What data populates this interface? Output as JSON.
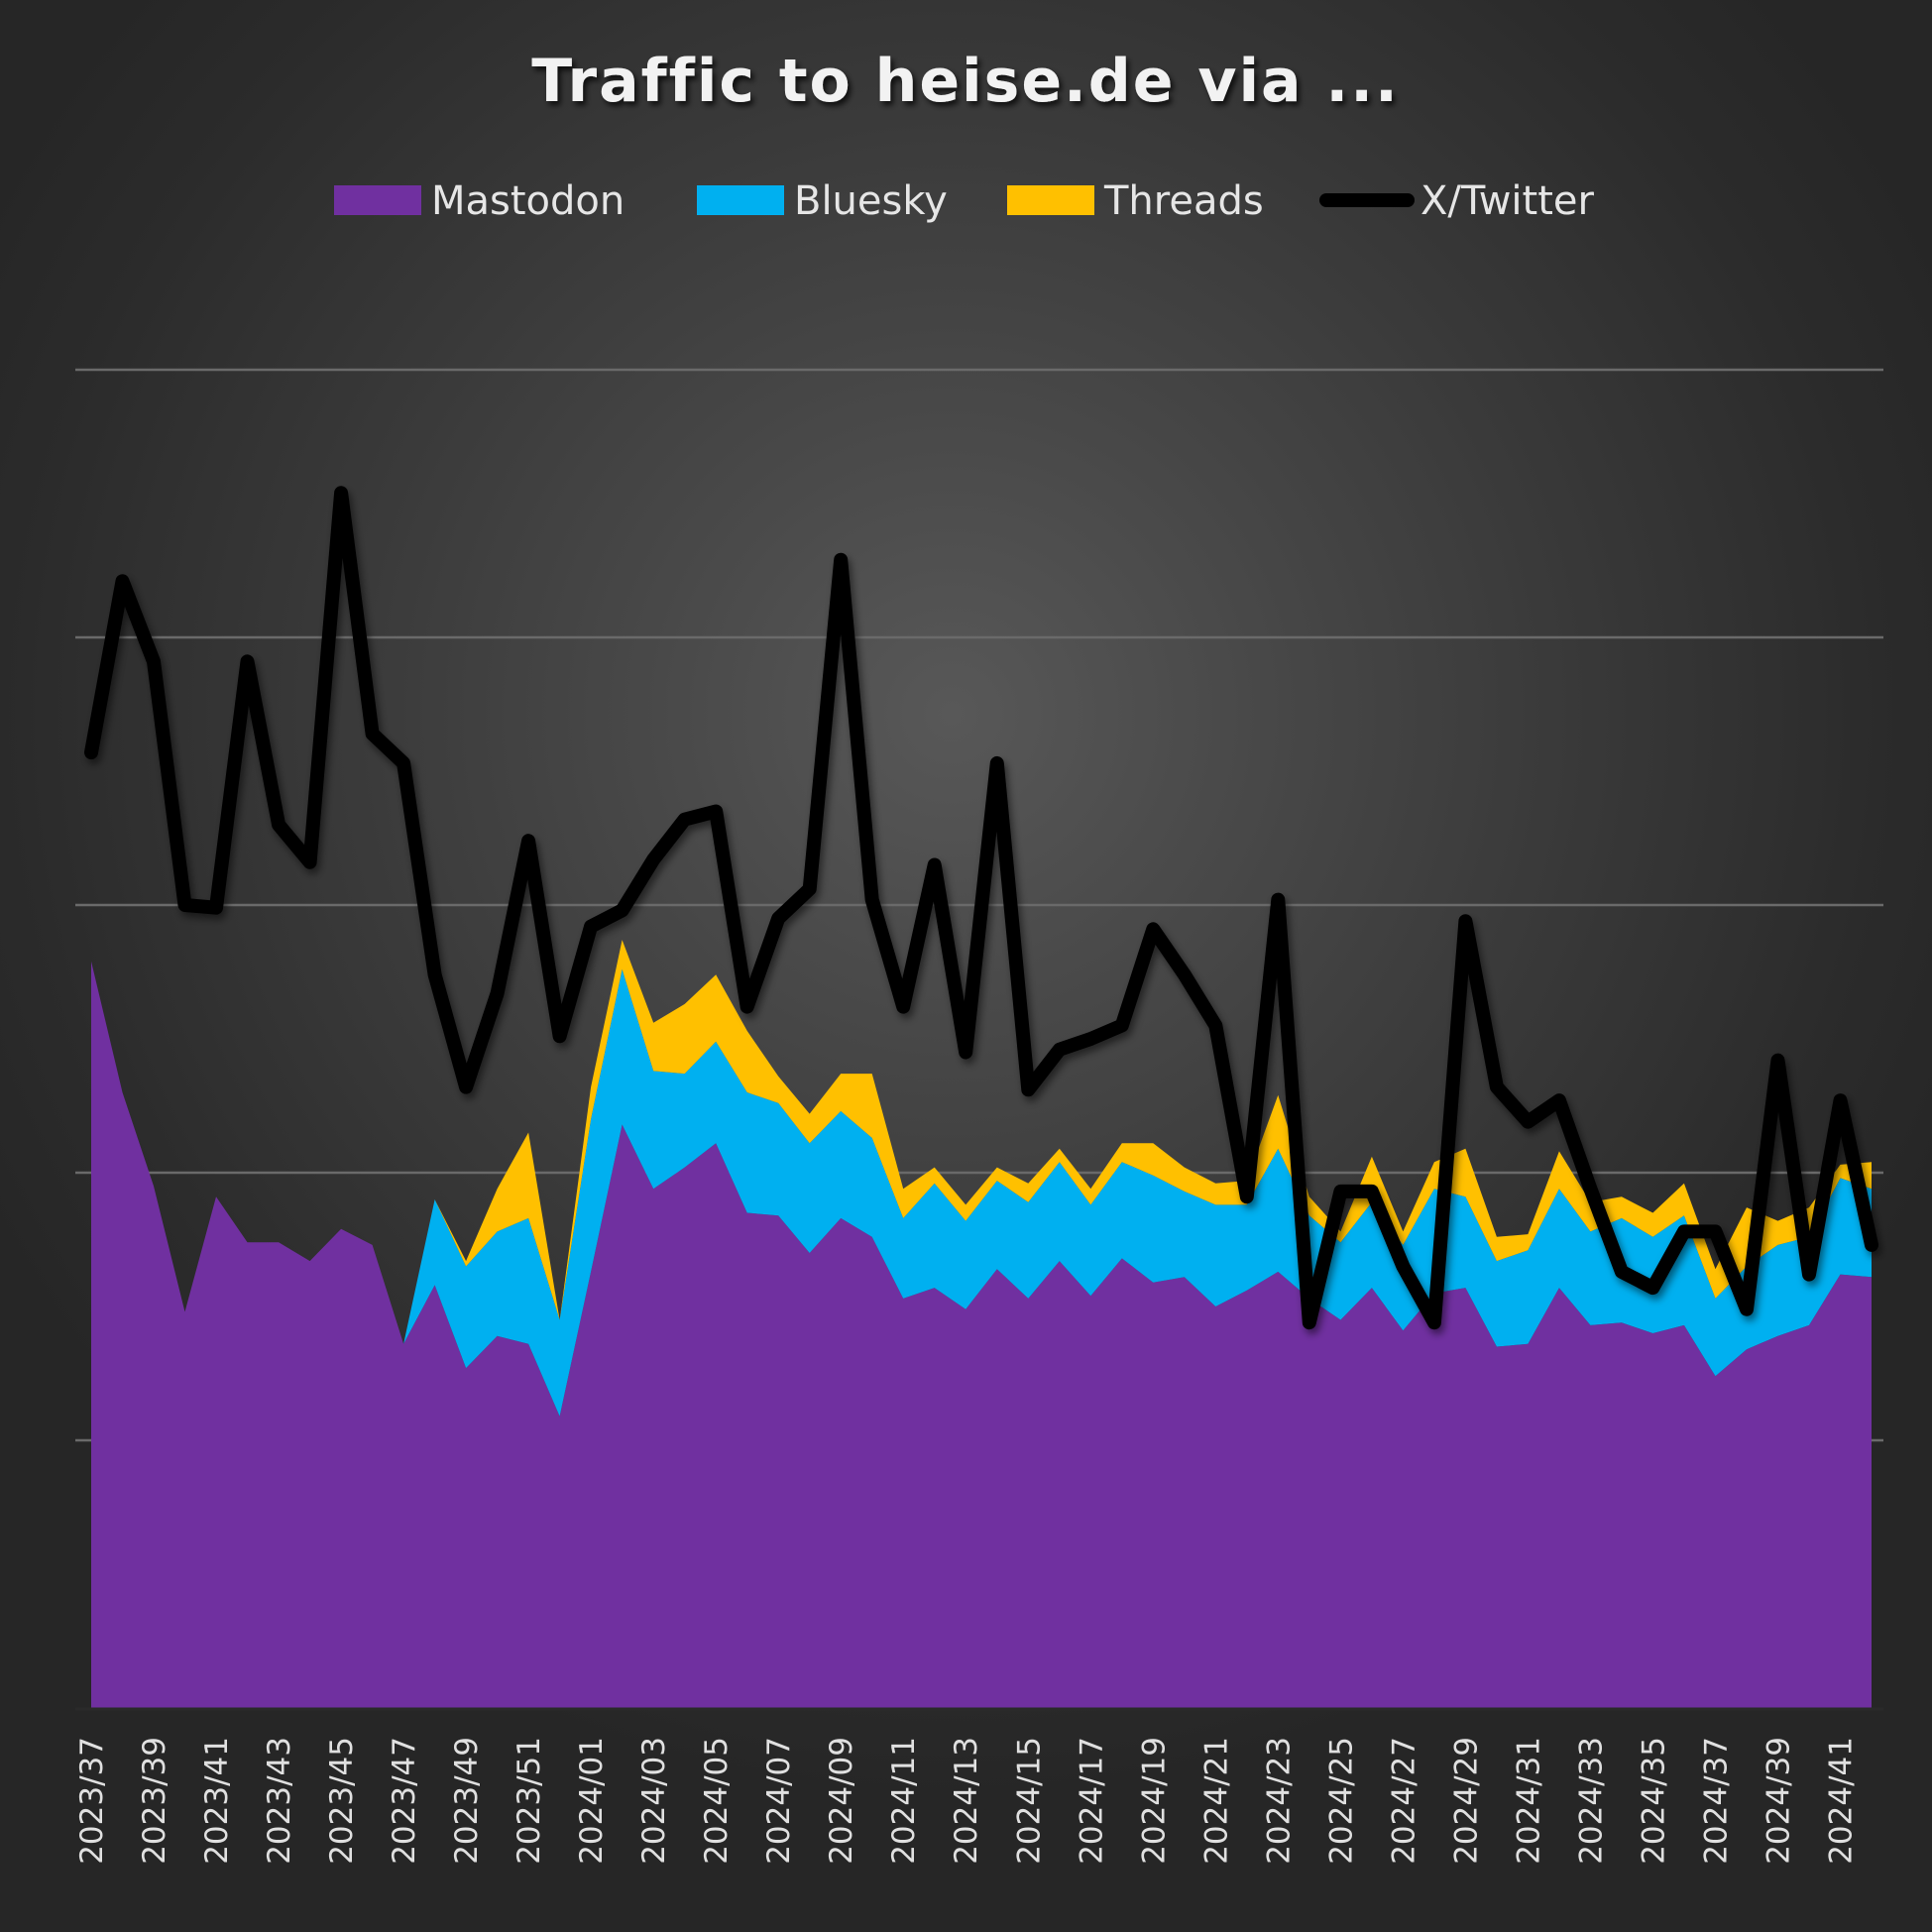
{
  "chart_data": {
    "type": "area",
    "subtype": "stacked area with line overlay",
    "title": "Traffic to heise.de via ...",
    "xlabel": "",
    "ylabel": "",
    "y_units": "relative (unlabeled axis; 1 unit = 1 gridline interval)",
    "ylim": [
      0,
      5
    ],
    "grid": true,
    "legend_position": "top-center",
    "legend": [
      {
        "name": "Mastodon",
        "kind": "area",
        "color": "#7030A0"
      },
      {
        "name": "Bluesky",
        "kind": "area",
        "color": "#00B0F0"
      },
      {
        "name": "Threads",
        "kind": "area",
        "color": "#FFC000"
      },
      {
        "name": "X/Twitter",
        "kind": "line",
        "color": "#000000"
      }
    ],
    "x": [
      "2023/37",
      "2023/38",
      "2023/39",
      "2023/40",
      "2023/41",
      "2023/42",
      "2023/43",
      "2023/44",
      "2023/45",
      "2023/46",
      "2023/47",
      "2023/48",
      "2023/49",
      "2023/50",
      "2023/51",
      "2023/52",
      "2024/01",
      "2024/02",
      "2024/03",
      "2024/04",
      "2024/05",
      "2024/06",
      "2024/07",
      "2024/08",
      "2024/09",
      "2024/10",
      "2024/11",
      "2024/12",
      "2024/13",
      "2024/14",
      "2024/15",
      "2024/16",
      "2024/17",
      "2024/18",
      "2024/19",
      "2024/20",
      "2024/21",
      "2024/22",
      "2024/23",
      "2024/24",
      "2024/25",
      "2024/26",
      "2024/27",
      "2024/28",
      "2024/29",
      "2024/30",
      "2024/31",
      "2024/32",
      "2024/33",
      "2024/34",
      "2024/35",
      "2024/36",
      "2024/37",
      "2024/38",
      "2024/39",
      "2024/40",
      "2024/41",
      "2024/42"
    ],
    "tick_labels": [
      "2023/37",
      "2023/39",
      "2023/41",
      "2023/43",
      "2023/45",
      "2023/47",
      "2023/49",
      "2023/51",
      "2024/01",
      "2024/03",
      "2024/05",
      "2024/07",
      "2024/09",
      "2024/11",
      "2024/13",
      "2024/15",
      "2024/17",
      "2024/19",
      "2024/21",
      "2024/23",
      "2024/25",
      "2024/27",
      "2024/29",
      "2024/31",
      "2024/33",
      "2024/35",
      "2024/37",
      "2024/39",
      "2024/41"
    ],
    "tick_every": 2,
    "series": [
      {
        "name": "Mastodon",
        "stacked": true,
        "values": [
          2.79,
          2.3,
          1.95,
          1.48,
          1.91,
          1.74,
          1.74,
          1.67,
          1.79,
          1.73,
          1.36,
          1.58,
          1.27,
          1.39,
          1.36,
          1.09,
          1.63,
          2.18,
          1.94,
          2.02,
          2.11,
          1.85,
          1.84,
          1.7,
          1.83,
          1.76,
          1.53,
          1.57,
          1.49,
          1.64,
          1.53,
          1.67,
          1.54,
          1.68,
          1.59,
          1.61,
          1.5,
          1.56,
          1.63,
          1.53,
          1.45,
          1.57,
          1.41,
          1.55,
          1.57,
          1.35,
          1.36,
          1.57,
          1.43,
          1.44,
          1.4,
          1.43,
          1.24,
          1.34,
          1.39,
          1.43,
          1.62,
          1.61
        ]
      },
      {
        "name": "Bluesky",
        "stacked": true,
        "values": [
          0,
          0,
          0,
          0,
          0,
          0,
          0,
          0,
          0,
          0,
          0,
          0.32,
          0.38,
          0.39,
          0.47,
          0.36,
          0.57,
          0.58,
          0.44,
          0.35,
          0.38,
          0.45,
          0.42,
          0.41,
          0.4,
          0.37,
          0.3,
          0.39,
          0.33,
          0.33,
          0.36,
          0.37,
          0.34,
          0.36,
          0.4,
          0.32,
          0.38,
          0.32,
          0.46,
          0.31,
          0.29,
          0.32,
          0.32,
          0.39,
          0.34,
          0.32,
          0.35,
          0.37,
          0.35,
          0.39,
          0.36,
          0.41,
          0.29,
          0.31,
          0.34,
          0.33,
          0.36,
          0.33
        ]
      },
      {
        "name": "Threads",
        "stacked": true,
        "values": [
          0,
          0,
          0,
          0,
          0,
          0,
          0,
          0,
          0,
          0,
          0,
          0,
          0.02,
          0.16,
          0.32,
          0,
          0.12,
          0.11,
          0.18,
          0.26,
          0.25,
          0.23,
          0.1,
          0.11,
          0.14,
          0.24,
          0.11,
          0.06,
          0.06,
          0.05,
          0.07,
          0.05,
          0.06,
          0.07,
          0.12,
          0.09,
          0.08,
          0.09,
          0.2,
          0.07,
          0.04,
          0.17,
          0.05,
          0.1,
          0.18,
          0.09,
          0.06,
          0.14,
          0.11,
          0.08,
          0.09,
          0.12,
          0.11,
          0.22,
          0.09,
          0.11,
          0.05,
          0.1
        ]
      },
      {
        "name": "X/Twitter",
        "stacked": false,
        "values": [
          3.57,
          4.21,
          3.91,
          3.0,
          2.99,
          3.91,
          3.3,
          3.16,
          4.54,
          3.64,
          3.53,
          2.74,
          2.32,
          2.67,
          3.24,
          2.51,
          2.92,
          2.98,
          3.17,
          3.32,
          3.35,
          2.62,
          2.95,
          3.06,
          4.29,
          3.02,
          2.62,
          3.15,
          2.45,
          3.53,
          2.31,
          2.46,
          2.5,
          2.55,
          2.91,
          2.74,
          2.55,
          1.91,
          3.02,
          1.44,
          1.93,
          1.93,
          1.65,
          1.44,
          2.94,
          2.32,
          2.19,
          2.27,
          1.94,
          1.63,
          1.57,
          1.78,
          1.78,
          1.49,
          2.42,
          1.62,
          2.27,
          1.73
        ]
      }
    ]
  }
}
